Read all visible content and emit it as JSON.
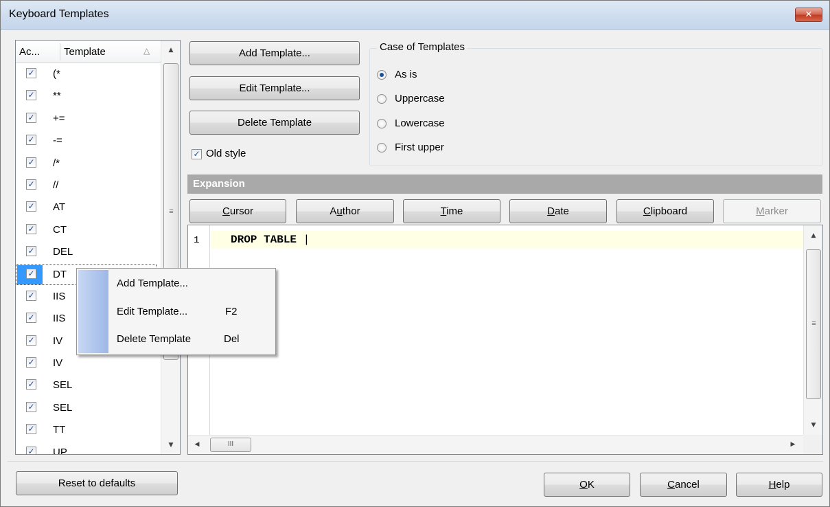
{
  "window": {
    "title": "Keyboard Templates",
    "close_glyph": "✕"
  },
  "list": {
    "headers": {
      "active": "Ac...",
      "template": "Template",
      "sort_glyph": "△"
    },
    "rows": [
      {
        "label": "(*",
        "checked": true
      },
      {
        "label": "**",
        "checked": true
      },
      {
        "label": "+=",
        "checked": true
      },
      {
        "label": "-=",
        "checked": true
      },
      {
        "label": "/*",
        "checked": true
      },
      {
        "label": "//",
        "checked": true
      },
      {
        "label": "AT",
        "checked": true
      },
      {
        "label": "CT",
        "checked": true
      },
      {
        "label": "DEL",
        "checked": true
      },
      {
        "label": "DT",
        "checked": true,
        "selected": true
      },
      {
        "label": "IIS",
        "checked": true
      },
      {
        "label": "IIS",
        "checked": true
      },
      {
        "label": "IV",
        "checked": true
      },
      {
        "label": "IV",
        "checked": true
      },
      {
        "label": "SEL",
        "checked": true
      },
      {
        "label": "SEL",
        "checked": true
      },
      {
        "label": "TT",
        "checked": true
      },
      {
        "label": "UP",
        "checked": true
      }
    ]
  },
  "actions": {
    "add": "Add Template...",
    "edit": "Edit Template...",
    "delete": "Delete Template",
    "old_style": "Old style",
    "old_style_checked": true
  },
  "case": {
    "title": "Case of Templates",
    "options": [
      "As is",
      "Uppercase",
      "Lowercase",
      "First upper"
    ],
    "selected": "As is"
  },
  "expansion": {
    "title": "Expansion",
    "buttons": {
      "cursor": {
        "mnemonic": "C",
        "rest": "ursor"
      },
      "author": {
        "pre": "A",
        "mnemonic": "u",
        "rest": "thor"
      },
      "time": {
        "mnemonic": "T",
        "rest": "ime"
      },
      "date": {
        "mnemonic": "D",
        "rest": "ate"
      },
      "clipboard": {
        "mnemonic": "C",
        "rest": "lipboard"
      },
      "marker": {
        "mnemonic": "M",
        "rest": "arker"
      }
    },
    "editor": {
      "line_number": "1",
      "code": "DROP TABLE ",
      "caret": "|"
    }
  },
  "context_menu": {
    "items": [
      {
        "label": "Add Template...",
        "shortcut": ""
      },
      {
        "label": "Edit Template...",
        "shortcut": "F2"
      },
      {
        "label": "Delete Template",
        "shortcut": "Del"
      }
    ]
  },
  "footer": {
    "reset": "Reset to defaults",
    "ok": {
      "mnemonic": "O",
      "rest": "K"
    },
    "cancel": {
      "mnemonic": "C",
      "rest": "ancel"
    },
    "help": {
      "mnemonic": "H",
      "rest": "elp"
    }
  }
}
